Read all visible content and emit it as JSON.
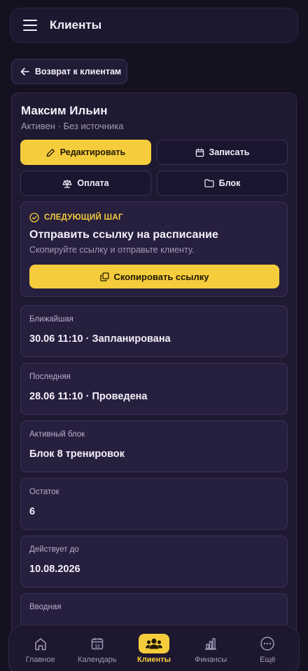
{
  "header": {
    "title": "Клиенты"
  },
  "back_label": "Возврат к клиентам",
  "client": {
    "name": "Максим Ильин",
    "meta": "Активен · Без источника"
  },
  "actions": {
    "edit": "Редактировать",
    "book": "Записать",
    "pay": "Оплата",
    "block": "Блок"
  },
  "next_step": {
    "label": "СЛЕДУЮЩИЙ ШАГ",
    "title": "Отправить ссылку на расписание",
    "description": "Скопируйте ссылку и отправьте клиенту.",
    "button": "Скопировать ссылку"
  },
  "info": [
    {
      "label": "Ближайшая",
      "value": "30.06 11:10 · Запланирована"
    },
    {
      "label": "Последняя",
      "value": "28.06 11:10 · Проведена"
    },
    {
      "label": "Активный блок",
      "value": "Блок 8 тренировок"
    },
    {
      "label": "Остаток",
      "value": "6"
    },
    {
      "label": "Действует до",
      "value": "10.08.2026"
    },
    {
      "label": "Вводная",
      "value": ""
    }
  ],
  "nav": {
    "items": [
      {
        "label": "Главное",
        "icon": "home-icon"
      },
      {
        "label": "Календарь",
        "icon": "calendar-icon",
        "badge": "12"
      },
      {
        "label": "Клиенты",
        "icon": "clients-icon",
        "active": true
      },
      {
        "label": "Финансы",
        "icon": "chart-icon"
      },
      {
        "label": "Ещё",
        "icon": "more-icon"
      }
    ]
  },
  "colors": {
    "accent": "#f5cd3c",
    "background": "#151121",
    "card": "#1f1932"
  }
}
